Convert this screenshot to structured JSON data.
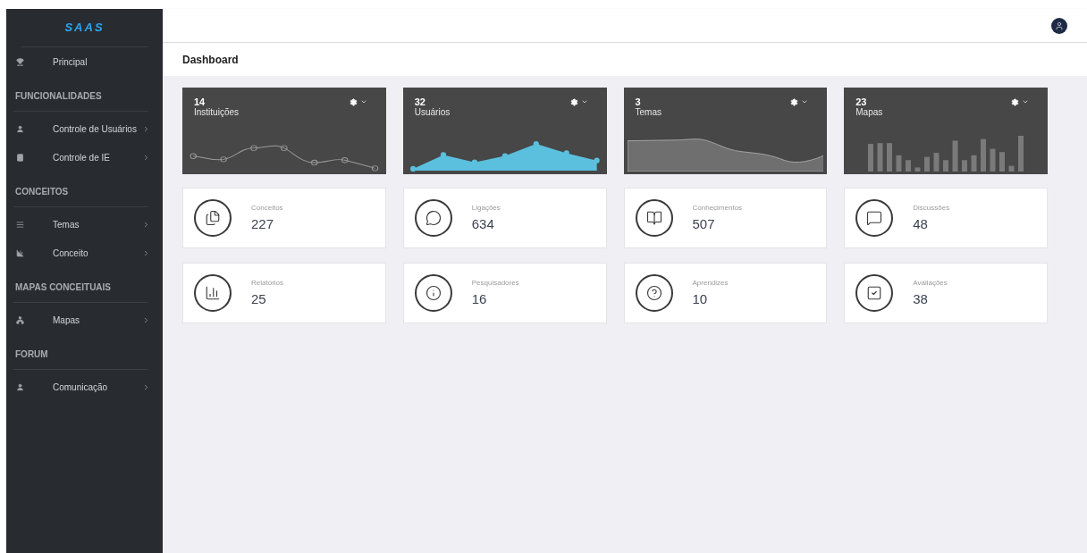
{
  "sidebar": {
    "logo": "SAAS",
    "sections": [
      {
        "items": [
          {
            "label": "Principal",
            "has_submenu": false
          }
        ]
      },
      {
        "title": "FUNCIONALIDADES",
        "items": [
          {
            "label": "Controle de Usuários",
            "has_submenu": true
          },
          {
            "label": "Controle de IE",
            "has_submenu": true
          }
        ]
      },
      {
        "title": "CONCEITOS",
        "items": [
          {
            "label": "Temas",
            "has_submenu": true
          },
          {
            "label": "Conceito",
            "has_submenu": true
          }
        ]
      },
      {
        "title": "MAPAS CONCEITUAIS",
        "items": [
          {
            "label": "Mapas",
            "has_submenu": true
          }
        ]
      },
      {
        "title": "FORUM",
        "items": [
          {
            "label": "Comunicação",
            "has_submenu": true
          }
        ]
      }
    ]
  },
  "page_title": "Dashboard",
  "chart_cards": [
    {
      "value": "14",
      "label": "Instituições",
      "kind": "line"
    },
    {
      "value": "32",
      "label": "Usuários",
      "kind": "area"
    },
    {
      "value": "3",
      "label": "Temas",
      "kind": "wave"
    },
    {
      "value": "23",
      "label": "Mapas",
      "kind": "bars"
    }
  ],
  "stat_cards": [
    {
      "label": "Conceitos",
      "value": "227"
    },
    {
      "label": "Ligações",
      "value": "634"
    },
    {
      "label": "Conhecimentos",
      "value": "507"
    },
    {
      "label": "Discussões",
      "value": "48"
    },
    {
      "label": "Relatórios",
      "value": "25"
    },
    {
      "label": "Pesquisadores",
      "value": "16"
    },
    {
      "label": "Aprendizes",
      "value": "10"
    },
    {
      "label": "Avaliações",
      "value": "38"
    }
  ]
}
